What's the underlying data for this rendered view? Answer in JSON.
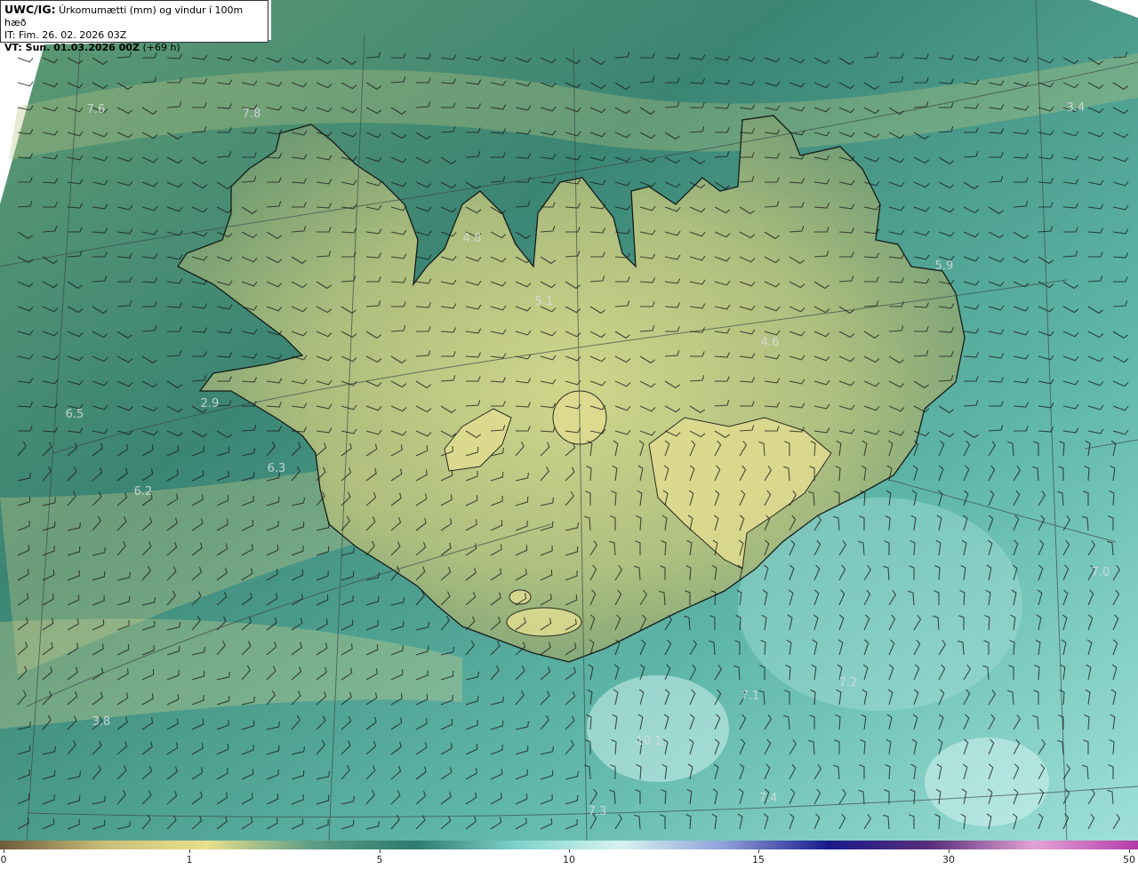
{
  "header": {
    "tag": "UWC/IG:",
    "title": "Úrkomumætti (mm) og vindur í 100m hæð",
    "it_line": "IT: Fim. 26. 02. 2026 03Z",
    "vt_prefix": "VT: Sun. 01.03.2026 00Z",
    "vt_suffix": "(+69 h)"
  },
  "colors": {
    "ocean_deep": "#2f7a6c",
    "ocean_light": "#8fd6cf",
    "land_yellow": "#d8d98a",
    "land_mid": "#7fa66e",
    "coastline": "#111111",
    "grid": "#3c4a4a",
    "barb": "#1a1a1a"
  },
  "colorbar": {
    "ticks": [
      "0",
      "1",
      "5",
      "10",
      "15",
      "30",
      "50"
    ],
    "stops": [
      "#6e5a3c",
      "#c9be78",
      "#e8e08c",
      "#5e9e86",
      "#2e7a6e",
      "#7fd3cb",
      "#d6f3f1",
      "#8fa0d8",
      "#1a1a8c",
      "#5a2f7a",
      "#e3a3d6",
      "#b43aa8"
    ]
  },
  "map_labels": [
    {
      "text": "7.6"
    },
    {
      "text": "7.8"
    },
    {
      "text": "3.4"
    },
    {
      "text": "4.8"
    },
    {
      "text": "5.9"
    },
    {
      "text": "5.1"
    },
    {
      "text": "4.6"
    },
    {
      "text": "6.5"
    },
    {
      "text": "2.9"
    },
    {
      "text": "6.3"
    },
    {
      "text": "6.2"
    },
    {
      "text": "7.0"
    },
    {
      "text": "7.2"
    },
    {
      "text": "7.1"
    },
    {
      "text": "3.8"
    },
    {
      "text": "10.1"
    },
    {
      "text": "7.4"
    },
    {
      "text": "7.3"
    }
  ]
}
